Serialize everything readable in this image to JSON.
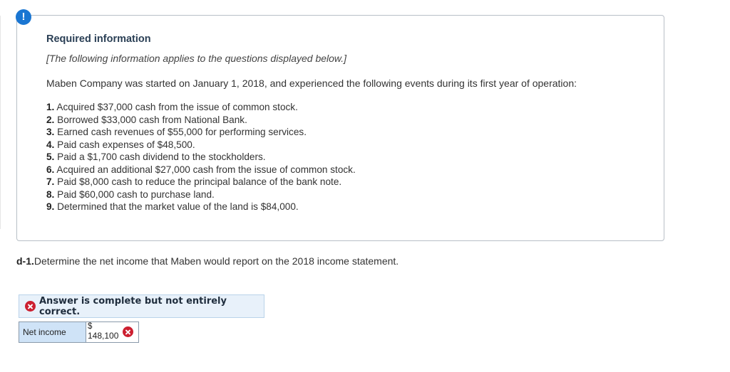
{
  "alert": {
    "symbol": "!"
  },
  "info": {
    "title": "Required information",
    "note": "[The following information applies to the questions displayed below.]",
    "intro": "Maben Company was started on January 1, 2018, and experienced the following events during its first year of operation:",
    "events": [
      {
        "num": "1.",
        "text": "Acquired $37,000 cash from the issue of common stock."
      },
      {
        "num": "2.",
        "text": "Borrowed $33,000 cash from National Bank."
      },
      {
        "num": "3.",
        "text": "Earned cash revenues of $55,000 for performing services."
      },
      {
        "num": "4.",
        "text": "Paid cash expenses of $48,500."
      },
      {
        "num": "5.",
        "text": "Paid a $1,700 cash dividend to the stockholders."
      },
      {
        "num": "6.",
        "text": "Acquired an additional $27,000 cash from the issue of common stock."
      },
      {
        "num": "7.",
        "text": "Paid $8,000 cash to reduce the principal balance of the bank note."
      },
      {
        "num": "8.",
        "text": "Paid $60,000 cash to purchase land."
      },
      {
        "num": "9.",
        "text": "Determined that the market value of the land is $84,000."
      }
    ]
  },
  "question": {
    "number": "d-1.",
    "text": "Determine the net income that Maben would report on the 2018 income statement."
  },
  "status": {
    "text": "Answer is complete but not entirely correct.",
    "icon": "x-circle-icon",
    "color": "#cc1f30"
  },
  "answer": {
    "label": "Net income",
    "currency": "$",
    "value": "148,100",
    "correct": false
  }
}
